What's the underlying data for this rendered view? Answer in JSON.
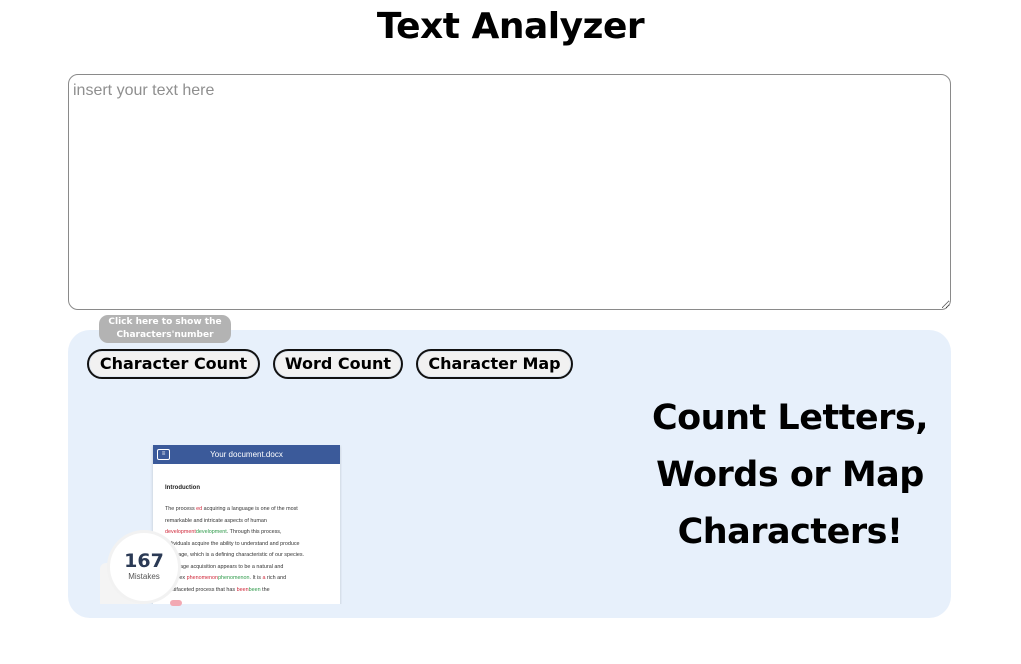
{
  "header": {
    "title": "Text Analyzer"
  },
  "input": {
    "placeholder": "insert your text here"
  },
  "tooltip": {
    "line1": "Click here to show the",
    "line2": "Characters'number"
  },
  "buttons": {
    "character_count": "Character Count",
    "word_count": "Word Count",
    "character_map": "Character Map"
  },
  "headline": {
    "line1": "Count Letters,",
    "line2": "Words or Map",
    "line3": "Characters!"
  },
  "preview": {
    "doc_title": "Your document.docx",
    "logo_glyph": "≡",
    "heading": "Introduction",
    "lines": [
      {
        "parts": [
          {
            "t": "The process "
          },
          {
            "t": "ed",
            "c": "red"
          },
          {
            "t": " acquiring a language is one of the most"
          }
        ]
      },
      {
        "parts": [
          {
            "t": "remarkable and intricate aspects of human"
          }
        ]
      },
      {
        "parts": [
          {
            "t": "development",
            "c": "red"
          },
          {
            "t": "development",
            "c": "green"
          },
          {
            "t": ". Through this process,"
          }
        ]
      },
      {
        "parts": [
          {
            "t": "individuals acquire the ability to understand and produce"
          }
        ]
      },
      {
        "parts": [
          {
            "t": "language, which is a defining characteristic of our species."
          }
        ]
      },
      {
        "parts": [
          {
            "t": "Language acquisition appears to be a natural and"
          }
        ]
      },
      {
        "parts": [
          {
            "t": "complex "
          },
          {
            "t": "phenomenon",
            "c": "red"
          },
          {
            "t": "phenomenon",
            "c": "green"
          },
          {
            "t": ". It is "
          },
          {
            "t": "a",
            "c": "red"
          },
          {
            "t": " rich and"
          }
        ]
      },
      {
        "parts": [
          {
            "t": "multifaceted process that has "
          },
          {
            "t": "been",
            "c": "red"
          },
          {
            "t": "been",
            "c": "green"
          },
          {
            "t": " the"
          }
        ]
      }
    ],
    "mistakes_count": "167",
    "mistakes_label": "Mistakes"
  },
  "colors": {
    "panel_bg": "#e7f0fb",
    "doc_header": "#3b5a9a",
    "tooltip_bg": "#b3b3b3"
  }
}
